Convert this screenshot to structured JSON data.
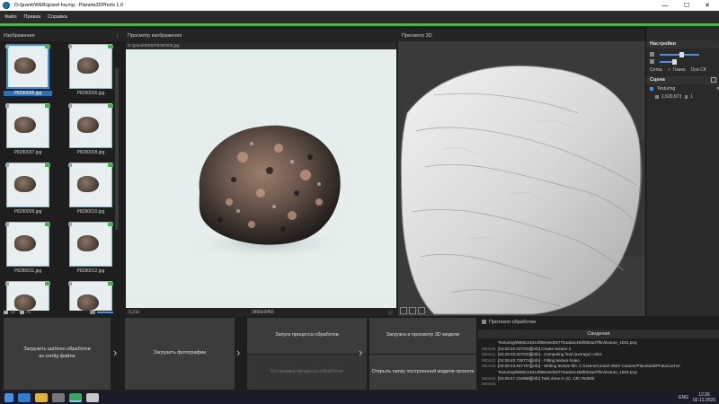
{
  "window": {
    "title": "D:/granit/WEB/granit hq.mg - Planeta3DPhoto 1.0",
    "minimize": "—",
    "maximize": "☐",
    "close": "✕"
  },
  "menu": [
    "Файл",
    "Правка",
    "Справка"
  ],
  "images_panel": {
    "title": "Изображения",
    "menu_icon": "⋮",
    "thumbs": [
      "P8280005.jpg",
      "P8280006.jpg",
      "P8280007.jpg",
      "P8280008.jpg",
      "P8280009.jpg",
      "P8280010.jpg",
      "P8280011.jpg",
      "P8280012.jpg",
      "",
      ""
    ],
    "selected_index": 0,
    "footer_count_a": "70",
    "footer_count_b": "70"
  },
  "preview_panel": {
    "title": "Просмотр изображения",
    "path": "D:/granit/WEB/P8280005.jpg",
    "zoom": "0.21x",
    "resolution": "3456x3456",
    "info_icon": "ⓘ"
  },
  "view3d_panel": {
    "title": "Просмотр 3D"
  },
  "settings_panel": {
    "title": "Настройки",
    "checkbox_grid": "Сетка",
    "checkbox_gizmo": "Гизмо",
    "axes": "Оси СК",
    "check_mark": "✓"
  },
  "scene_panel": {
    "title": "Сцена",
    "item_name": "Texturing",
    "item_stats": "1,620,973",
    "item_count": "1"
  },
  "actions": {
    "load_template": "Загрузить шаблон обработки\nиз config файла",
    "load_photos": "Загрузить фотографии",
    "start_processing": "Запуск процесса обработки",
    "stop_processing": "Остановка процесса обработки",
    "load_preview_3d": "Загрузка и просмотр 3D модели",
    "open_folder": "Открыть папку построенной модели проекта",
    "arrow": "›"
  },
  "log_panel": {
    "title": "Протокол обработки",
    "subtitle": "Сведения",
    "lines": [
      {
        "n": "",
        "t": "Texturing/9680c24614f69e3ed267764abac458f0b4ad7fbc/texture_1001.png"
      },
      {
        "n": "580440",
        "t": "[04:28:40.027023][info] Create texture 2"
      },
      {
        "n": "580441",
        "t": "[04:28:40.027023][info]  - Computing final (average) color."
      },
      {
        "n": "580442",
        "t": "[04:28:40.738774][info]  - Filling texture holes."
      },
      {
        "n": "580443",
        "t": "[04:28:43.847707][info]  - Writing texture file: C:/Users/Corsair 280X Custom/Planeta3DPhotoCache/"
      },
      {
        "n": "",
        "t": "Texturing/9680c24614f69e3ed267764abac458f0b4ad7fbc/texture_1002.png"
      },
      {
        "n": "580444",
        "t": "[04:28:47.104958][info] Task done in (s): 135.753000"
      },
      {
        "n": "580445",
        "t": ""
      }
    ]
  },
  "taskbar": {
    "lang": "ENG",
    "time": "12:26",
    "date": "02.12.2020"
  },
  "colors": {
    "accent_green": "#4bb44a",
    "selection_blue": "#2d6fb8"
  }
}
